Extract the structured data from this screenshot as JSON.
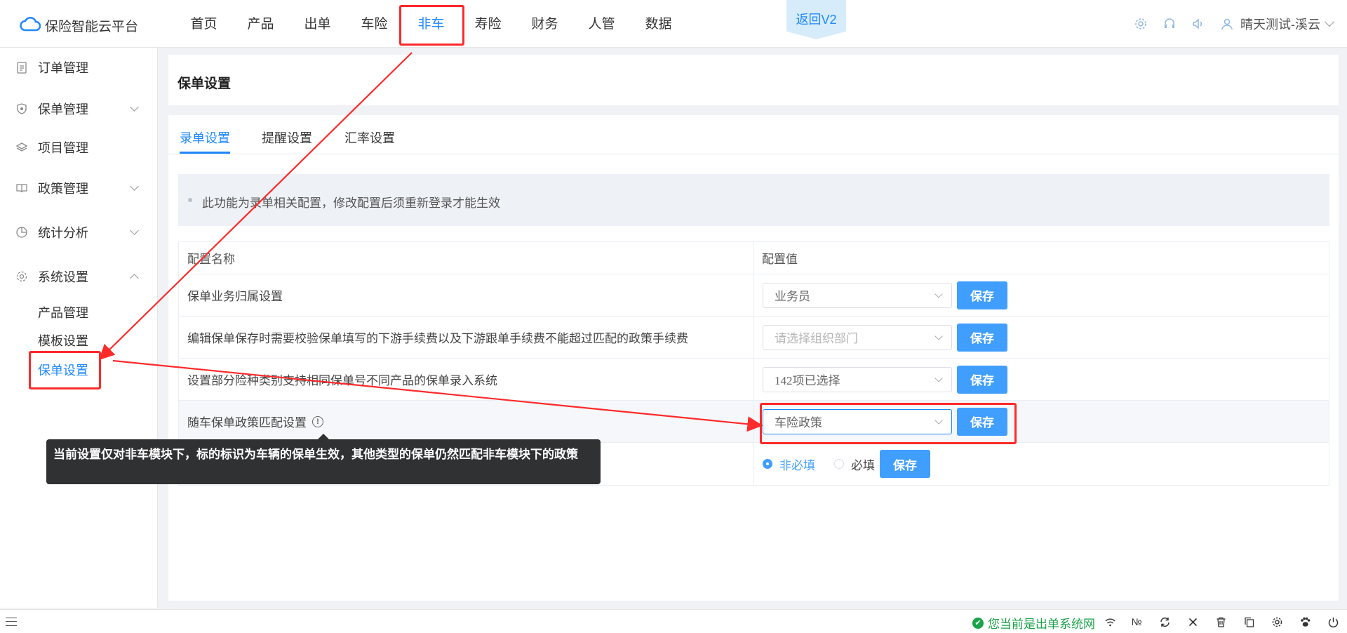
{
  "app": {
    "name": "保险智能云平台",
    "brand_color": "#1e88ff"
  },
  "nav": {
    "items": [
      {
        "label": "首页"
      },
      {
        "label": "产品"
      },
      {
        "label": "出单"
      },
      {
        "label": "车险"
      },
      {
        "label": "非车",
        "active": true
      },
      {
        "label": "寿险"
      },
      {
        "label": "财务"
      },
      {
        "label": "人管"
      },
      {
        "label": "数据"
      }
    ],
    "return_label": "返回V2"
  },
  "user": {
    "name": "晴天测试-溪云"
  },
  "header_icons": [
    "settings-icon",
    "headset-icon",
    "speaker-icon",
    "user-icon"
  ],
  "sidebar": {
    "items": [
      {
        "label": "订单管理",
        "icon": "clipboard-icon"
      },
      {
        "label": "保单管理",
        "icon": "shield-icon",
        "expandable": true
      },
      {
        "label": "项目管理",
        "icon": "layers-icon"
      },
      {
        "label": "政策管理",
        "icon": "book-icon",
        "expandable": true
      },
      {
        "label": "统计分析",
        "icon": "pie-chart-icon",
        "expandable": true
      },
      {
        "label": "系统设置",
        "icon": "gear-icon",
        "expandable": true,
        "expanded": true
      }
    ],
    "sub_items": [
      {
        "label": "产品管理"
      },
      {
        "label": "模板设置"
      },
      {
        "label": "保单设置",
        "active": true
      }
    ]
  },
  "page": {
    "title": "保单设置",
    "tabs": [
      {
        "label": "录单设置",
        "active": true
      },
      {
        "label": "提醒设置"
      },
      {
        "label": "汇率设置"
      }
    ],
    "notice": "此功能为录单相关配置，修改配置后须重新登录才能生效",
    "table": {
      "headers": {
        "name": "配置名称",
        "value": "配置值"
      },
      "rows": [
        {
          "name": "保单业务归属设置",
          "select_value": "业务员",
          "save": "保存"
        },
        {
          "name": "编辑保单保存时需要校验保单填写的下游手续费以及下游跟单手续费不能超过匹配的政策手续费",
          "select_placeholder": "请选择组织部门",
          "save": "保存"
        },
        {
          "name": "设置部分险种类别支持相同保单号不同产品的保单录入系统",
          "select_value": "142项已选择",
          "save": "保存"
        },
        {
          "name": "随车保单政策匹配设置",
          "select_value": "车险政策",
          "save": "保存",
          "info_icon": "info-icon"
        },
        {
          "name": "",
          "radio_options": [
            "非必填",
            "必填"
          ],
          "radio_selected": "非必填",
          "save": "保存"
        }
      ]
    },
    "tooltip": "当前设置仅对非车模块下，标的标识为车辆的保单生效，其他类型的保单仍然匹配非车模块下的政策"
  },
  "statusbar": {
    "status_text": "您当前是出单系统网",
    "icons": [
      "wifi-icon",
      "numero-icon",
      "refresh-icon",
      "close-icon",
      "trash-icon",
      "copy-icon",
      "settings-icon",
      "paw-icon",
      "power-icon"
    ]
  },
  "annotation_color": "#ff2a2a"
}
